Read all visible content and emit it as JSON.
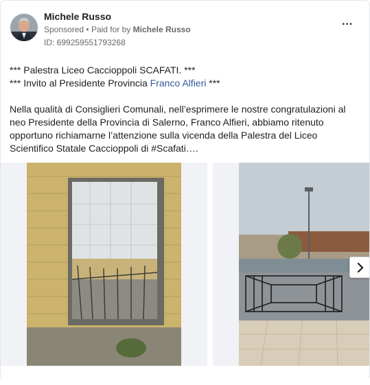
{
  "post": {
    "author": "Michele Russo",
    "sponsored_label": "Sponsored",
    "paid_for_prefix": "Paid for by",
    "paid_for_name": "Michele Russo",
    "ad_id": "ID: 699259551793268",
    "more_options": "···"
  },
  "body": {
    "line1": "*** Palestra Liceo Caccioppoli SCAFATI. ***",
    "line2_prefix": "*** Invito al Presidente Provincia ",
    "line2_link": "Franco Alfieri",
    "line2_suffix": " ***",
    "paragraph": "Nella qualità di Consiglieri Comunali, nell’esprimere le nostre congratulazioni al neo Presidente della Provincia di Salerno, Franco Alfieri, abbiamo ritenuto opportuno richiamarne l’attenzione sulla vicenda della Palestra del Liceo Scientifico Statale Caccioppoli di #Scafati…."
  },
  "carousel": {
    "images": [
      {
        "icon": "photo-gym-doorway"
      },
      {
        "icon": "photo-courtyard-gate"
      }
    ],
    "next_icon": "chevron-right-icon"
  },
  "colors": {
    "link": "#385898",
    "secondary_text": "#65676b",
    "border": "#e4e6eb"
  }
}
